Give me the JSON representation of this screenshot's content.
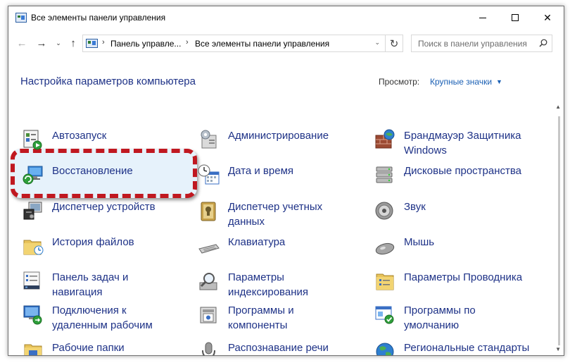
{
  "window": {
    "title": "Все элементы панели управления",
    "min_glyph": "",
    "close_glyph": "✕"
  },
  "nav": {
    "back_glyph": "←",
    "forward_glyph": "→",
    "recent_glyph": "⌄",
    "up_glyph": "↑",
    "refresh_glyph": "↻",
    "breadcrumb": [
      "Панель управле...",
      "Все элементы панели управления"
    ],
    "sep_glyph": "›",
    "dropdown_glyph": "⌄",
    "search_placeholder": "Поиск в панели управления"
  },
  "header": {
    "title": "Настройка параметров компьютера",
    "view_label": "Просмотр:",
    "view_value": "Крупные значки",
    "view_arrow": "▼"
  },
  "scroll": {
    "up_glyph": "▲",
    "down_glyph": "▼"
  },
  "items": [
    {
      "label": "Автозапуск",
      "icon": "autoplay-icon"
    },
    {
      "label": "Администрирование",
      "icon": "admin-tools-icon"
    },
    {
      "label": "Брандмауэр Защитника Windows",
      "icon": "firewall-icon"
    },
    {
      "label": "Восстановление",
      "icon": "recovery-icon"
    },
    {
      "label": "Дата и время",
      "icon": "datetime-icon"
    },
    {
      "label": "Дисковые пространства",
      "icon": "storage-spaces-icon"
    },
    {
      "label": "Диспетчер устройств",
      "icon": "device-manager-icon"
    },
    {
      "label": "Диспетчер учетных данных",
      "icon": "credential-manager-icon"
    },
    {
      "label": "Звук",
      "icon": "sound-icon"
    },
    {
      "label": "История файлов",
      "icon": "file-history-icon"
    },
    {
      "label": "Клавиатура",
      "icon": "keyboard-icon"
    },
    {
      "label": "Мышь",
      "icon": "mouse-icon"
    },
    {
      "label": "Панель задач и навигация",
      "icon": "taskbar-icon"
    },
    {
      "label": "Параметры индексирования",
      "icon": "indexing-icon"
    },
    {
      "label": "Параметры Проводника",
      "icon": "explorer-options-icon"
    },
    {
      "label": "Подключения к удаленным рабочим",
      "icon": "remote-desktop-icon"
    },
    {
      "label": "Программы и компоненты",
      "icon": "programs-icon"
    },
    {
      "label": "Программы по умолчанию",
      "icon": "default-programs-icon"
    },
    {
      "label": "Рабочие папки",
      "icon": "work-folders-icon"
    },
    {
      "label": "Распознавание речи",
      "icon": "speech-icon"
    },
    {
      "label": "Региональные стандарты",
      "icon": "region-icon"
    }
  ],
  "colors": {
    "link": "#1e3287",
    "accent": "#1a5fb4",
    "highlight_border": "#c01820",
    "highlight_fill": "#e6f2fb"
  }
}
